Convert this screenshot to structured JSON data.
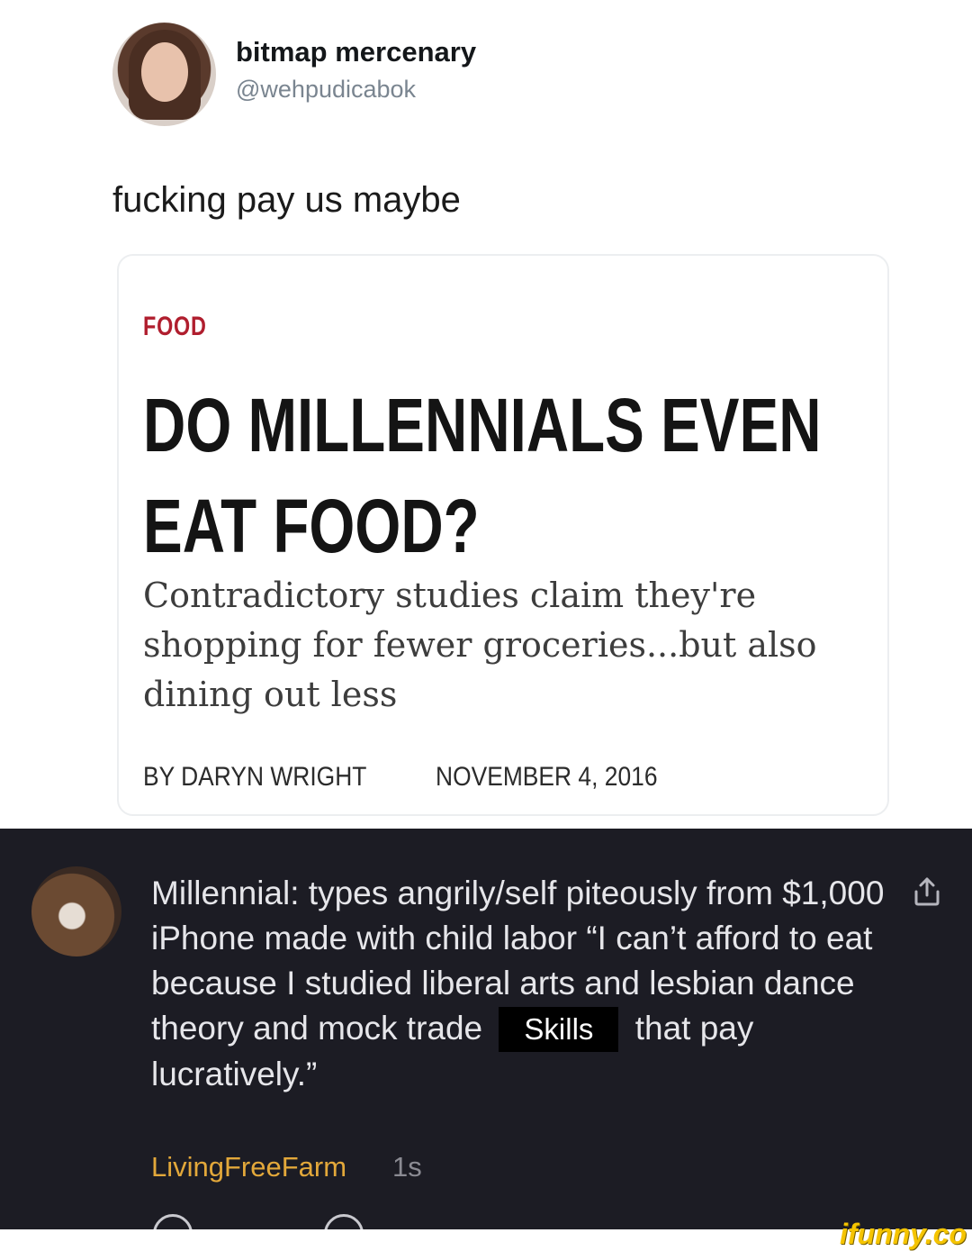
{
  "tweet": {
    "display_name": "bitmap mercenary",
    "handle": "@wehpudicabok",
    "text": "fucking pay us maybe"
  },
  "article_card": {
    "category": "FOOD",
    "headline": "DO MILLENNIALS EVEN EAT FOOD?",
    "subheadline": "Contradictory studies claim they're shopping for fewer groceries...but also dining out less",
    "byline": "BY DARYN WRIGHT",
    "date": "NOVEMBER 4, 2016"
  },
  "reply": {
    "text_part1": "Millennial: types angrily/self piteously from $1,000 iPhone made with child labor “I can’t afford to eat because I studied liberal arts and lesbian dance theory and mock trade",
    "highlight": "Skills",
    "text_part2": "that pay lucratively.”",
    "author": "LivingFreeFarm",
    "time": "1s",
    "share_icon": "share-icon"
  },
  "watermark": {
    "text": "ifunny.co"
  },
  "colors": {
    "reply_background": "#1c1c24",
    "author_color": "#e3a83a",
    "category_color": "#b01e2e"
  }
}
